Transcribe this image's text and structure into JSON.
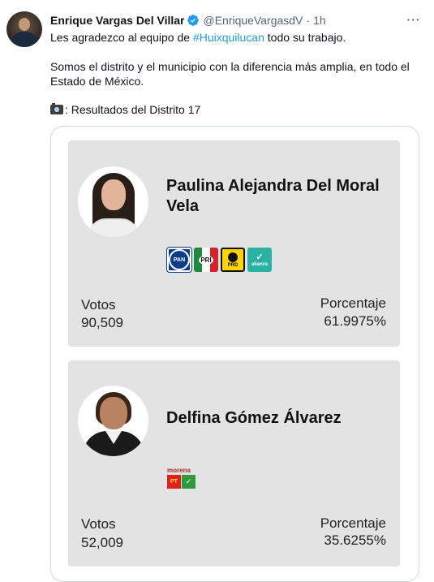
{
  "tweet": {
    "author_name": "Enrique Vargas Del Villar",
    "handle": "@EnriqueVargasdV",
    "separator": "·",
    "time": "1h",
    "more_label": "···",
    "line1_pre": "Les agradezco al equipo de ",
    "hashtag": "#Huixquilucan",
    "line1_post": " todo su trabajo.",
    "line2": "Somos el distrito y el municipio con la diferencia más amplia, en todo el",
    "line3": "Estado de México.",
    "line4": ": Resultados del Distrito 17"
  },
  "results": {
    "candidates": [
      {
        "name_line1": "Paulina Alejandra Del Moral",
        "name_line2": "Vela",
        "parties": [
          "PAN",
          "PRI",
          "PRD",
          "alianza"
        ],
        "votes_label": "Votos",
        "votes": "90,509",
        "pct_label": "Porcentaje",
        "pct": "61.9975%"
      },
      {
        "name_line1": "Delfina Gómez Álvarez",
        "name_line2": "",
        "parties": [
          "morena",
          "PT",
          "PVEM"
        ],
        "votes_label": "Votos",
        "votes": "52,009",
        "pct_label": "Porcentaje",
        "pct": "35.6255%"
      }
    ]
  },
  "colors": {
    "link": "#1d9bf0",
    "verified": "#1d9bf0",
    "card_bg": "#e3e3e3",
    "secondary_text": "#536471"
  },
  "icons": [
    "verified-badge-icon",
    "more-icon",
    "camera-icon"
  ]
}
